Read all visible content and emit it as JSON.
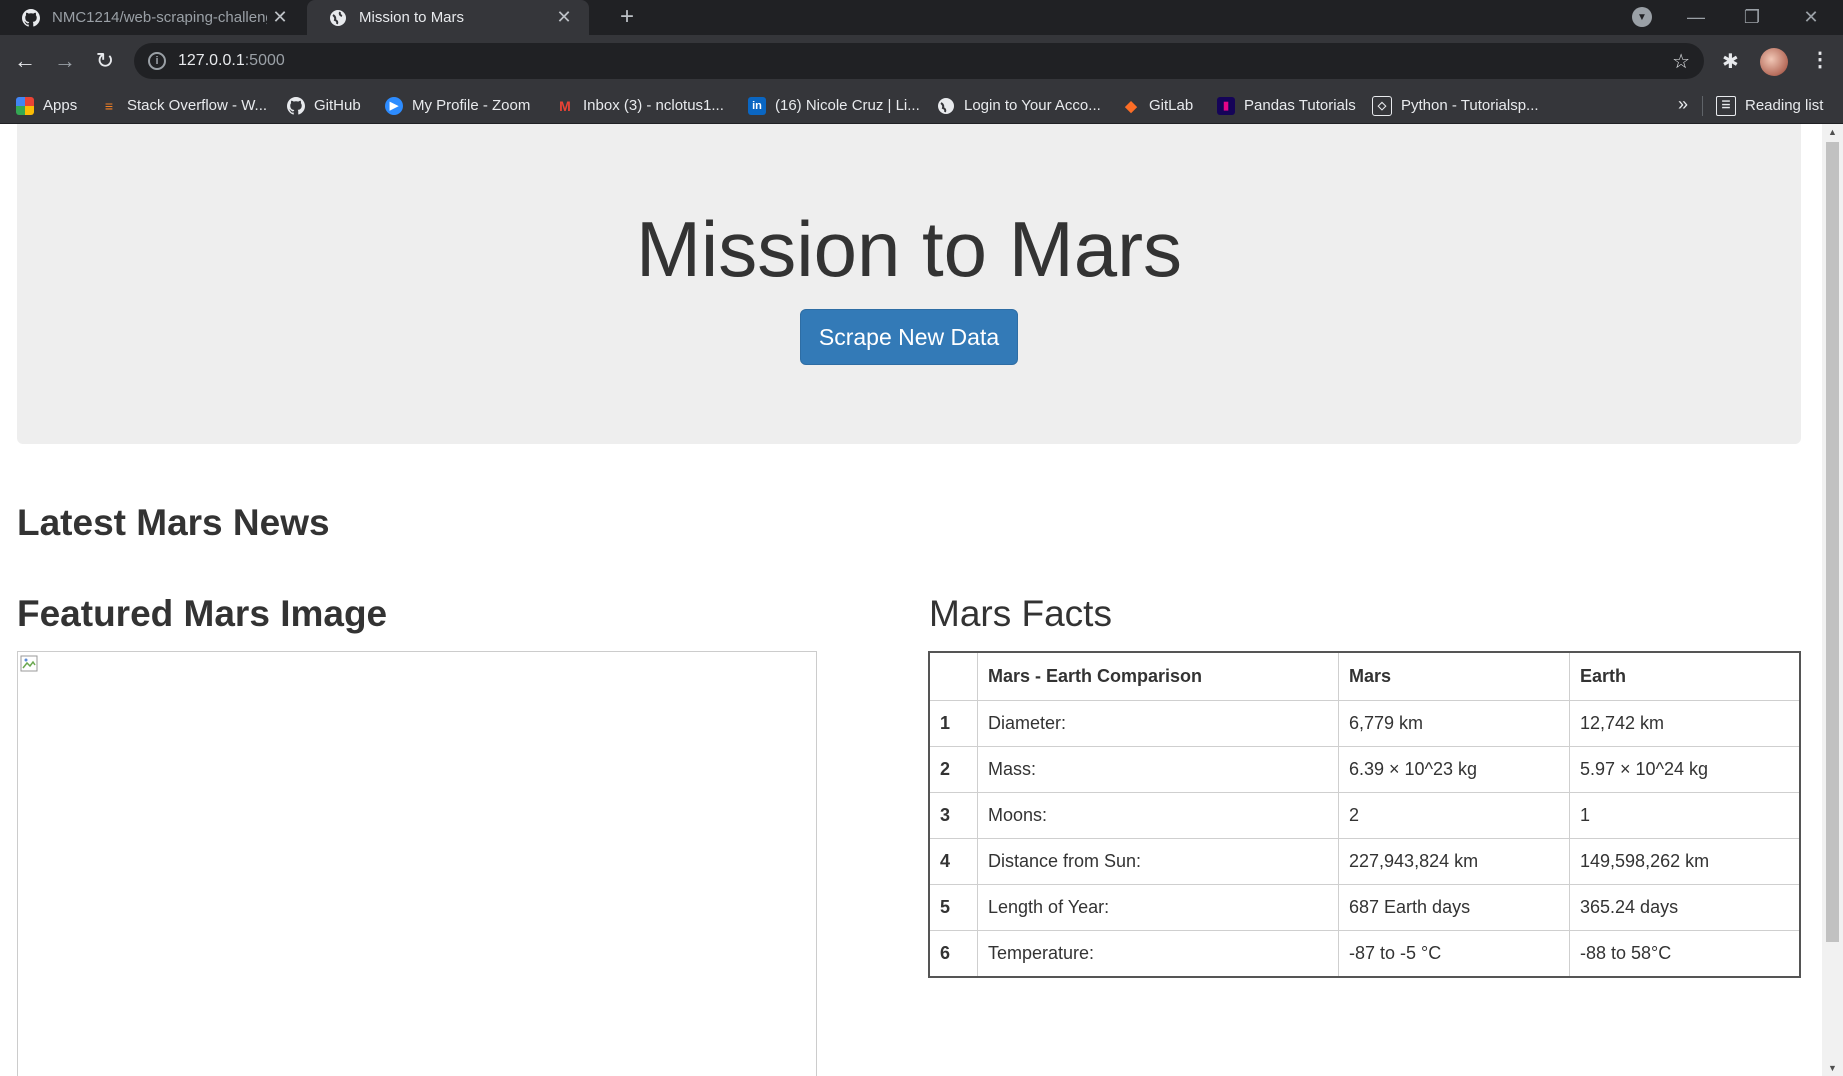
{
  "tabs": [
    {
      "title": "NMC1214/web-scraping-challenge",
      "icon": "github-icon"
    },
    {
      "title": "Mission to Mars",
      "icon": "globe-icon"
    }
  ],
  "address": {
    "host": "127.0.0.1",
    "port": ":5000"
  },
  "bookmarks": [
    {
      "label": "Apps",
      "icon": "apps-grid-icon"
    },
    {
      "label": "Stack Overflow - W...",
      "icon": "stackoverflow-icon"
    },
    {
      "label": "GitHub",
      "icon": "github-icon"
    },
    {
      "label": "My Profile - Zoom",
      "icon": "zoom-icon"
    },
    {
      "label": "Inbox (3) - nclotus1...",
      "icon": "gmail-icon"
    },
    {
      "label": "(16) Nicole Cruz | Li...",
      "icon": "linkedin-icon"
    },
    {
      "label": "Login to Your Acco...",
      "icon": "globe-icon"
    },
    {
      "label": "GitLab",
      "icon": "gitlab-icon"
    },
    {
      "label": "Pandas Tutorials",
      "icon": "pandas-icon"
    },
    {
      "label": "Python - Tutorialsp...",
      "icon": "tutorialspoint-icon"
    }
  ],
  "reading_list": "Reading list",
  "page": {
    "title": "Mission to Mars",
    "scrape_button": "Scrape New Data",
    "news_heading": "Latest Mars News",
    "featured_heading": "Featured Mars Image",
    "facts_heading": "Mars Facts",
    "facts_table": {
      "headers": [
        "",
        "Mars - Earth Comparison",
        "Mars",
        "Earth"
      ],
      "rows": [
        [
          "1",
          "Diameter:",
          "6,779 km",
          "12,742 km"
        ],
        [
          "2",
          "Mass:",
          "6.39 × 10^23 kg",
          "5.97 × 10^24 kg"
        ],
        [
          "3",
          "Moons:",
          "2",
          "1"
        ],
        [
          "4",
          "Distance from Sun:",
          "227,943,824 km",
          "149,598,262 km"
        ],
        [
          "5",
          "Length of Year:",
          "687 Earth days",
          "365.24 days"
        ],
        [
          "6",
          "Temperature:",
          "-87 to -5 °C",
          "-88 to 58°C"
        ]
      ]
    }
  }
}
